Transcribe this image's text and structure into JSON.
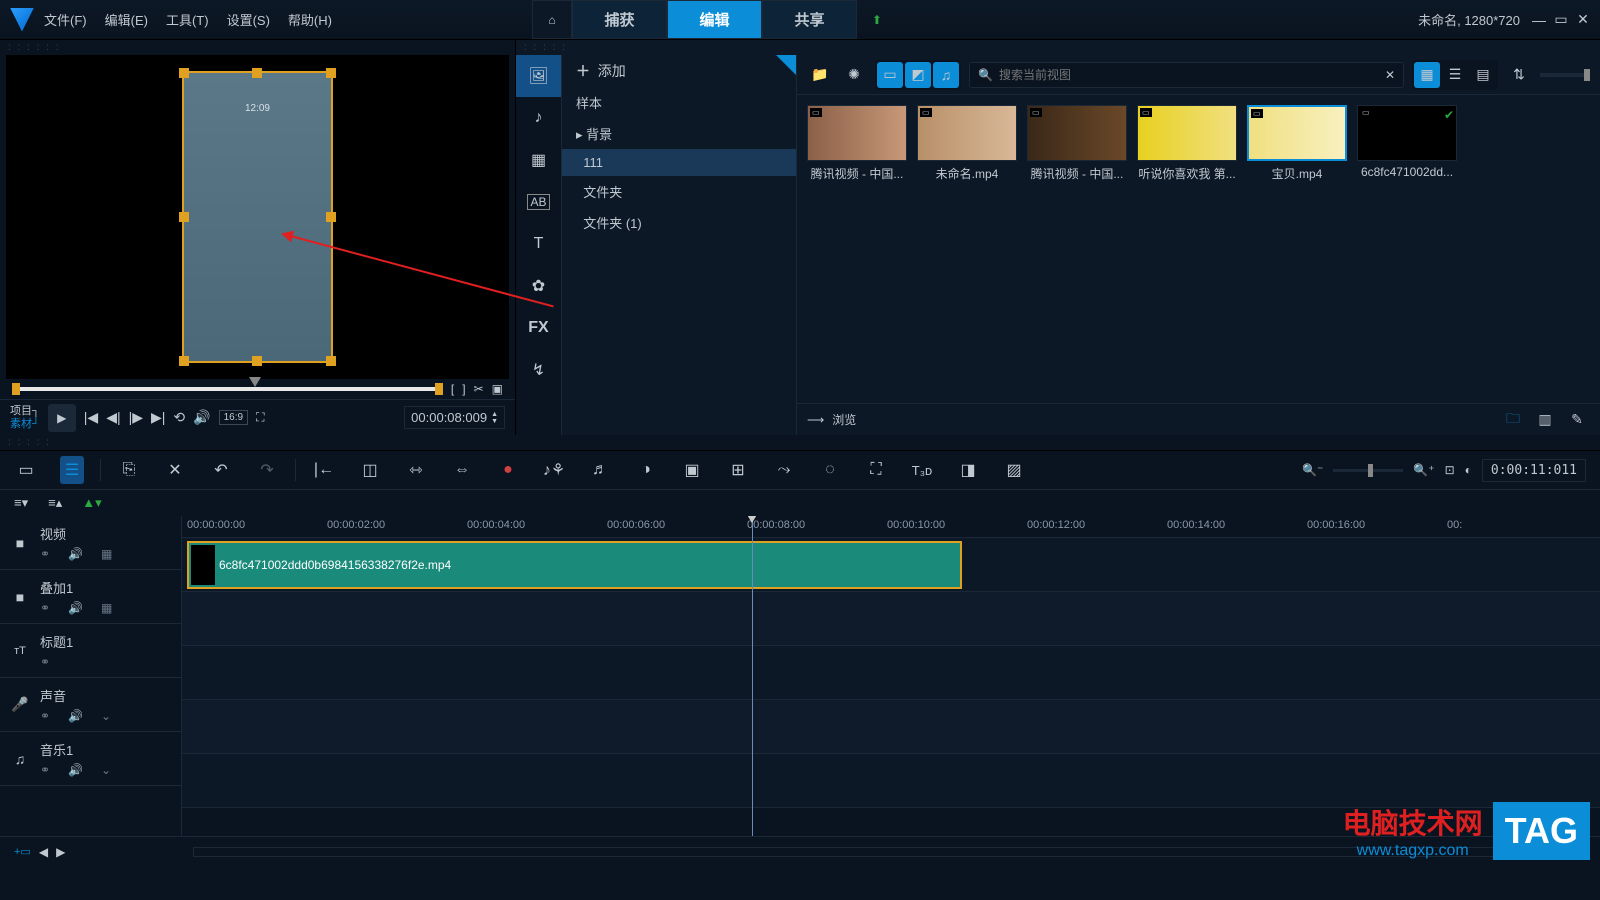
{
  "menu": {
    "file": "文件(F)",
    "edit": "编辑(E)",
    "tools": "工具(T)",
    "settings": "设置(S)",
    "help": "帮助(H)"
  },
  "tabs": {
    "capture": "捕获",
    "edit": "编辑",
    "share": "共享"
  },
  "project_info": "未命名, 1280*720",
  "preview": {
    "mode_project": "项目",
    "mode_clip": "素材",
    "timecode": "00:00:08:009",
    "aspect": "16:9",
    "overlay_time": "12:09"
  },
  "library": {
    "add": "添加",
    "tree": {
      "sample": "样本",
      "background": "背景",
      "sel": "111",
      "folder": "文件夹",
      "folder1": "文件夹 (1)"
    },
    "search_placeholder": "搜索当前视图",
    "browse": "浏览",
    "clips": [
      {
        "name": "腾讯视频 - 中国..."
      },
      {
        "name": "未命名.mp4"
      },
      {
        "name": "腾讯视频 - 中国..."
      },
      {
        "name": "听说你喜欢我 第..."
      },
      {
        "name": "宝贝.mp4"
      },
      {
        "name": "6c8fc471002dd..."
      }
    ]
  },
  "timeline": {
    "timecode": "0:00:11:011",
    "ruler": [
      "00:00:00:00",
      "00:00:02:00",
      "00:00:04:00",
      "00:00:06:00",
      "00:00:08:00",
      "00:00:10:00",
      "00:00:12:00",
      "00:00:14:00",
      "00:00:16:00",
      "00:"
    ],
    "tracks": {
      "video": "视频",
      "overlay": "叠加1",
      "title": "标题1",
      "voice": "声音",
      "music": "音乐1"
    },
    "clip_name": "6c8fc471002ddd0b6984156338276f2e.mp4"
  },
  "watermark": {
    "cn": "电脑技术网",
    "url": "www.tagxp.com",
    "tag": "TAG"
  }
}
